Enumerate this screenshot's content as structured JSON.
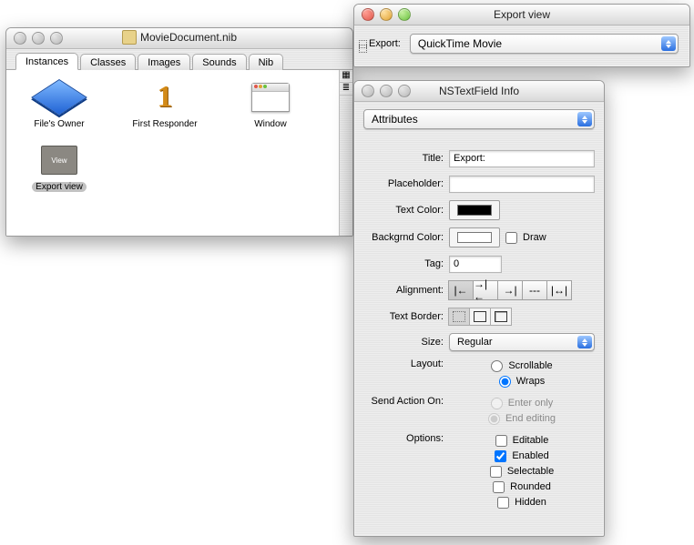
{
  "ib_window": {
    "title": "MovieDocument.nib",
    "tabs": [
      "Instances",
      "Classes",
      "Images",
      "Sounds",
      "Nib"
    ],
    "active_tab_index": 0,
    "items": [
      {
        "label": "File's Owner"
      },
      {
        "label": "First Responder"
      },
      {
        "label": "Window"
      },
      {
        "label": "Export view"
      }
    ],
    "selected_item_index": 3
  },
  "export_window": {
    "title": "Export view",
    "field_label": "Export:",
    "popup_value": "QuickTime Movie"
  },
  "info_panel": {
    "title": "NSTextField Info",
    "section_popup": "Attributes",
    "labels": {
      "title": "Title:",
      "placeholder": "Placeholder:",
      "text_color": "Text Color:",
      "bg_color": "Backgrnd Color:",
      "draw": "Draw",
      "tag": "Tag:",
      "alignment": "Alignment:",
      "text_border": "Text Border:",
      "size": "Size:",
      "layout": "Layout:",
      "send_action": "Send Action On:",
      "options": "Options:"
    },
    "values": {
      "title": "Export:",
      "placeholder": "",
      "text_color": "#000000",
      "bg_color": "#ffffff",
      "draw": false,
      "tag": "0",
      "alignment_selected": 0,
      "text_border_selected": 0,
      "size": "Regular",
      "layout": "Wraps",
      "layout_options": [
        "Scrollable",
        "Wraps"
      ],
      "send_action": "End editing",
      "send_action_options": [
        "Enter only",
        "End editing"
      ],
      "options": {
        "Editable": false,
        "Enabled": true,
        "Selectable": false,
        "Rounded": false,
        "Hidden": false
      }
    }
  }
}
